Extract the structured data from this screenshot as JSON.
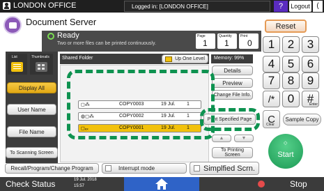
{
  "topbar": {
    "user_icon": "user-icon",
    "title": "LONDON OFFICE",
    "logged_in": "Logged in: [LONDON OFFICE]",
    "help": "?",
    "logout": "Logout",
    "extra": "(",
    "help_color": "#5a2cc0"
  },
  "header": {
    "app_title": "Document Server",
    "status_title": "Ready",
    "status_message": "Two or more files can be printed continuously.",
    "page_label": "Page",
    "page_value": "1",
    "quantity_label": "Quantity",
    "quantity_value": "1",
    "print_label": "Print",
    "print_value": "0",
    "reset": "Reset"
  },
  "panel": {
    "list_tab": "List",
    "thumbnails_tab": "Thumbnails",
    "folder": "Shared Folder",
    "up_one_level": "Up One Level",
    "memory": "Memory: 99%"
  },
  "left_buttons": {
    "display_all": "Display All",
    "user_name": "User Name",
    "file_name": "File Name",
    "to_scanning": "To Scanning Screen"
  },
  "files": [
    {
      "name": "COPY0003",
      "date": "19 Jul.",
      "pages": "1"
    },
    {
      "name": "COPY0002",
      "date": "19 Jul.",
      "pages": "1"
    },
    {
      "name": "COPY0001",
      "date": "19 Jul.",
      "pages": "1"
    }
  ],
  "right_buttons": {
    "details": "Details",
    "preview": "Preview",
    "change_file_info": "Change File Info.",
    "print_specified_page": "Print Specified Page",
    "to_printing": "To Printing Screen"
  },
  "keypad": {
    "keys": [
      "1",
      "2",
      "3",
      "4",
      "5",
      "6",
      "7",
      "8",
      "9",
      "/*",
      "0",
      "#"
    ],
    "enter": "Enter",
    "clear": "Clear",
    "sample_copy": "Sample Copy",
    "start": "Start"
  },
  "bottom": {
    "recall": "Recall/Program/Change Program",
    "interrupt": "Interrupt mode",
    "simplified": "Simplfied Scrn."
  },
  "statusbar": {
    "check_status": "Check Status",
    "date": "19 Jul. 2018",
    "time": "15:57",
    "stop": "Stop"
  }
}
